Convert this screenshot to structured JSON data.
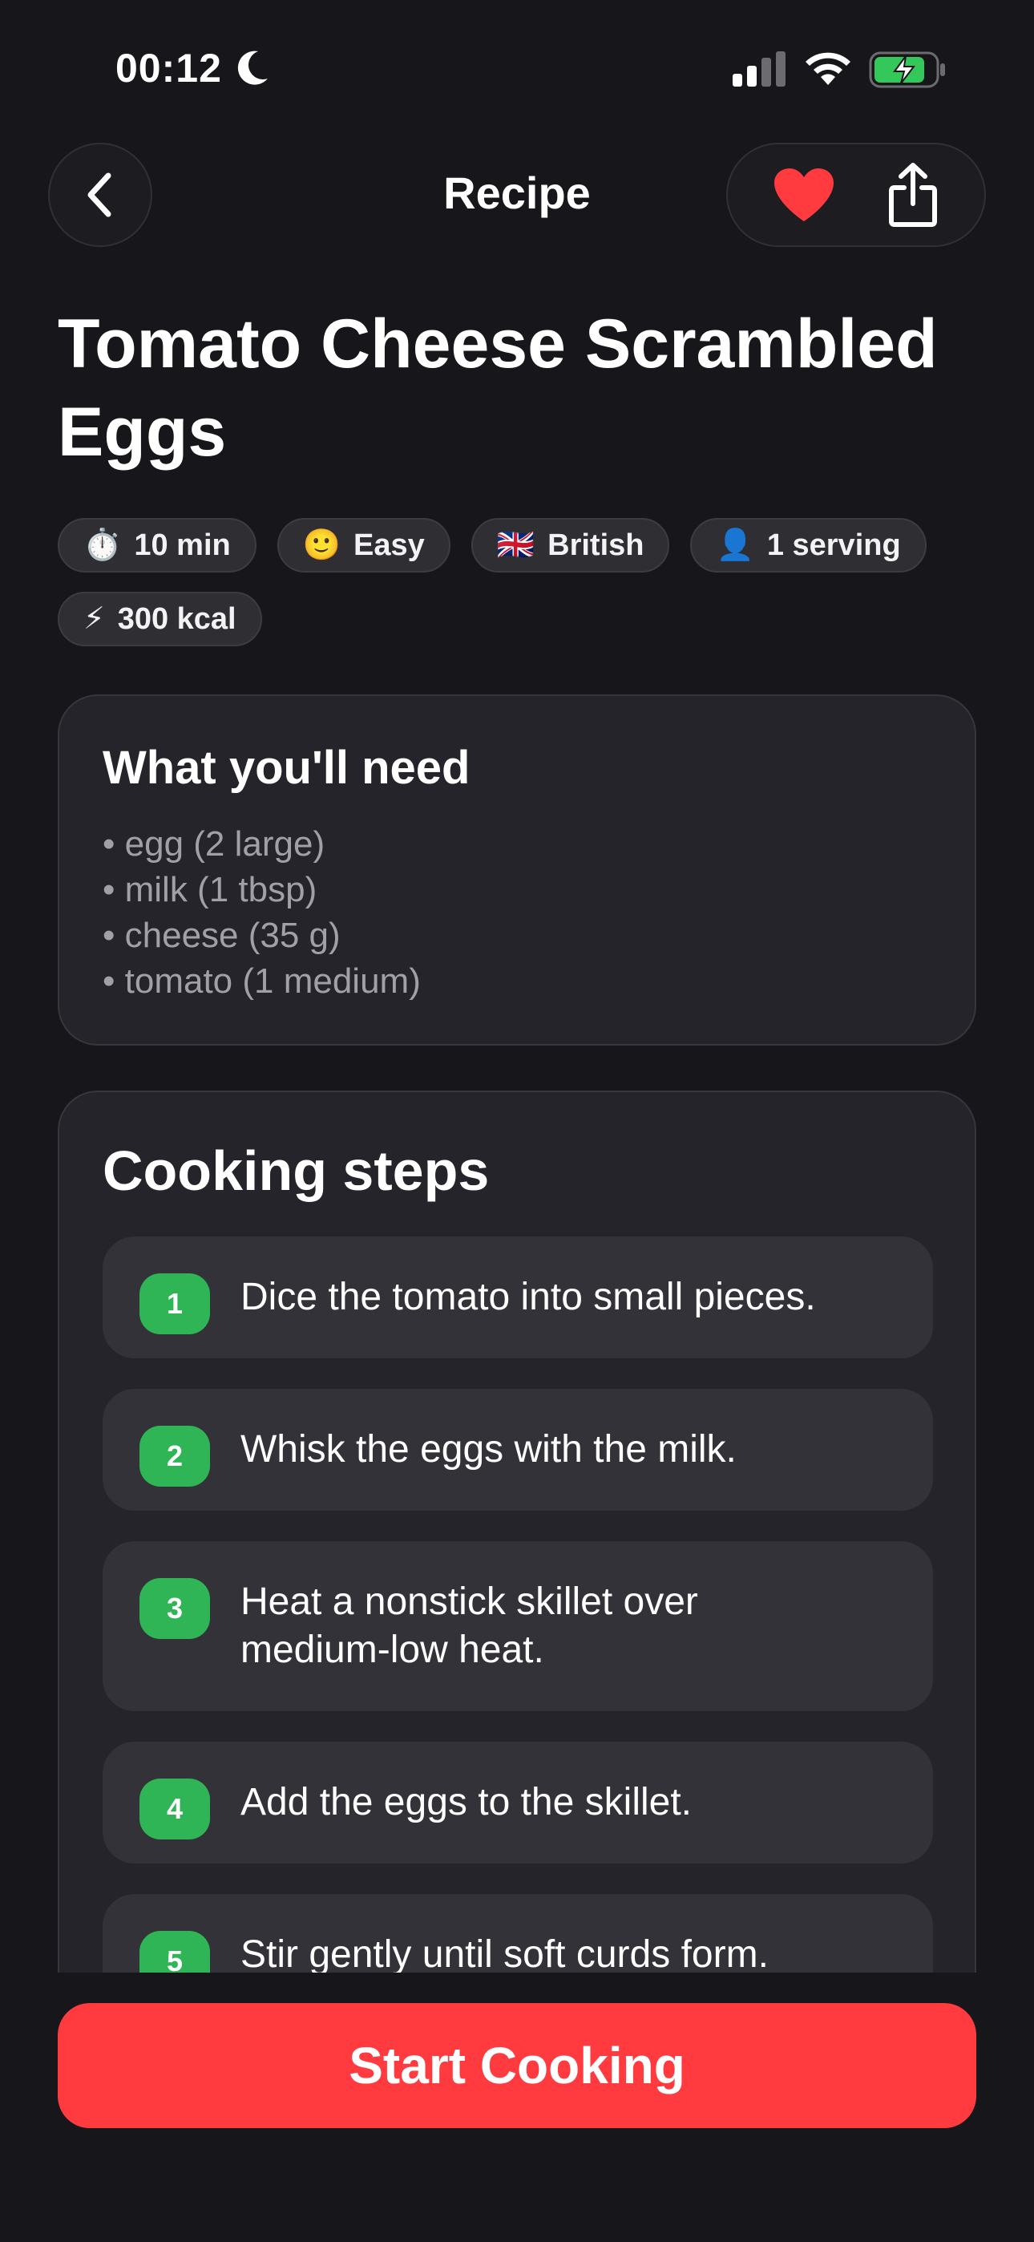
{
  "status_bar": {
    "time": "00:12"
  },
  "nav": {
    "title": "Recipe"
  },
  "recipe": {
    "title": "Tomato Cheese Scrambled Eggs",
    "tags": [
      {
        "emoji": "⏱️",
        "label": "10 min"
      },
      {
        "emoji": "🙂",
        "label": "Easy"
      },
      {
        "emoji": "🇬🇧",
        "label": "British"
      },
      {
        "emoji": "👤",
        "label": "1 serving"
      },
      {
        "emoji": "⚡",
        "label": "300 kcal"
      }
    ]
  },
  "ingredients": {
    "heading": "What you'll need",
    "items": [
      "• egg (2 large)",
      "• milk (1 tbsp)",
      "• cheese (35 g)",
      "• tomato (1 medium)"
    ]
  },
  "steps": {
    "heading": "Cooking steps",
    "items": [
      {
        "number": "1",
        "text": "Dice the tomato into small pieces."
      },
      {
        "number": "2",
        "text": "Whisk the eggs with the milk."
      },
      {
        "number": "3",
        "text": "Heat a nonstick skillet over medium-low heat."
      },
      {
        "number": "4",
        "text": "Add the eggs to the skillet."
      },
      {
        "number": "5",
        "text": "Stir gently until soft curds form."
      }
    ]
  },
  "actions": {
    "start_label": "Start Cooking"
  },
  "colors": {
    "accent": "#ff3b40",
    "step_badge": "#2fb456",
    "favorite": "#ff3b40",
    "battery": "#34c759"
  },
  "icons": {
    "back": "chevron-left-icon",
    "favorite": "heart-icon",
    "share": "share-icon"
  }
}
